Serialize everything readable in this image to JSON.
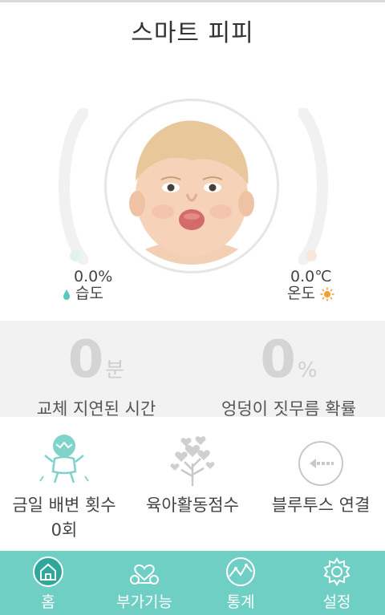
{
  "app": {
    "title": "스마트 피피"
  },
  "colors": {
    "accent": "#6fcfc4",
    "water": "#5cc7c0",
    "sun": "#f0a030",
    "gauge_track": "#f1f1f1"
  },
  "sensors": {
    "humidity": {
      "value": "0.0%",
      "label": "습도",
      "icon": "water-drop-icon"
    },
    "temperature": {
      "value": "0.0℃",
      "label": "온도",
      "icon": "sun-icon"
    }
  },
  "stats": {
    "delay": {
      "number": "0",
      "unit": "분",
      "label": "교체 지연된 시간"
    },
    "rash": {
      "number": "0",
      "unit": "%",
      "label": "엉덩이 짓무름 확률"
    }
  },
  "features": {
    "excretion": {
      "label": "금일 배변 횟수",
      "count": "0회",
      "icon": "crying-baby-icon"
    },
    "care_score": {
      "label": "육아활동점수",
      "icon": "heart-tree-icon"
    },
    "bluetooth": {
      "label": "블루투스 연결",
      "icon": "bluetooth-connect-icon"
    }
  },
  "nav": [
    {
      "label": "홈",
      "icon": "home-icon"
    },
    {
      "label": "부가기능",
      "icon": "extra-features-icon"
    },
    {
      "label": "통계",
      "icon": "statistics-icon"
    },
    {
      "label": "설정",
      "icon": "settings-icon"
    }
  ]
}
